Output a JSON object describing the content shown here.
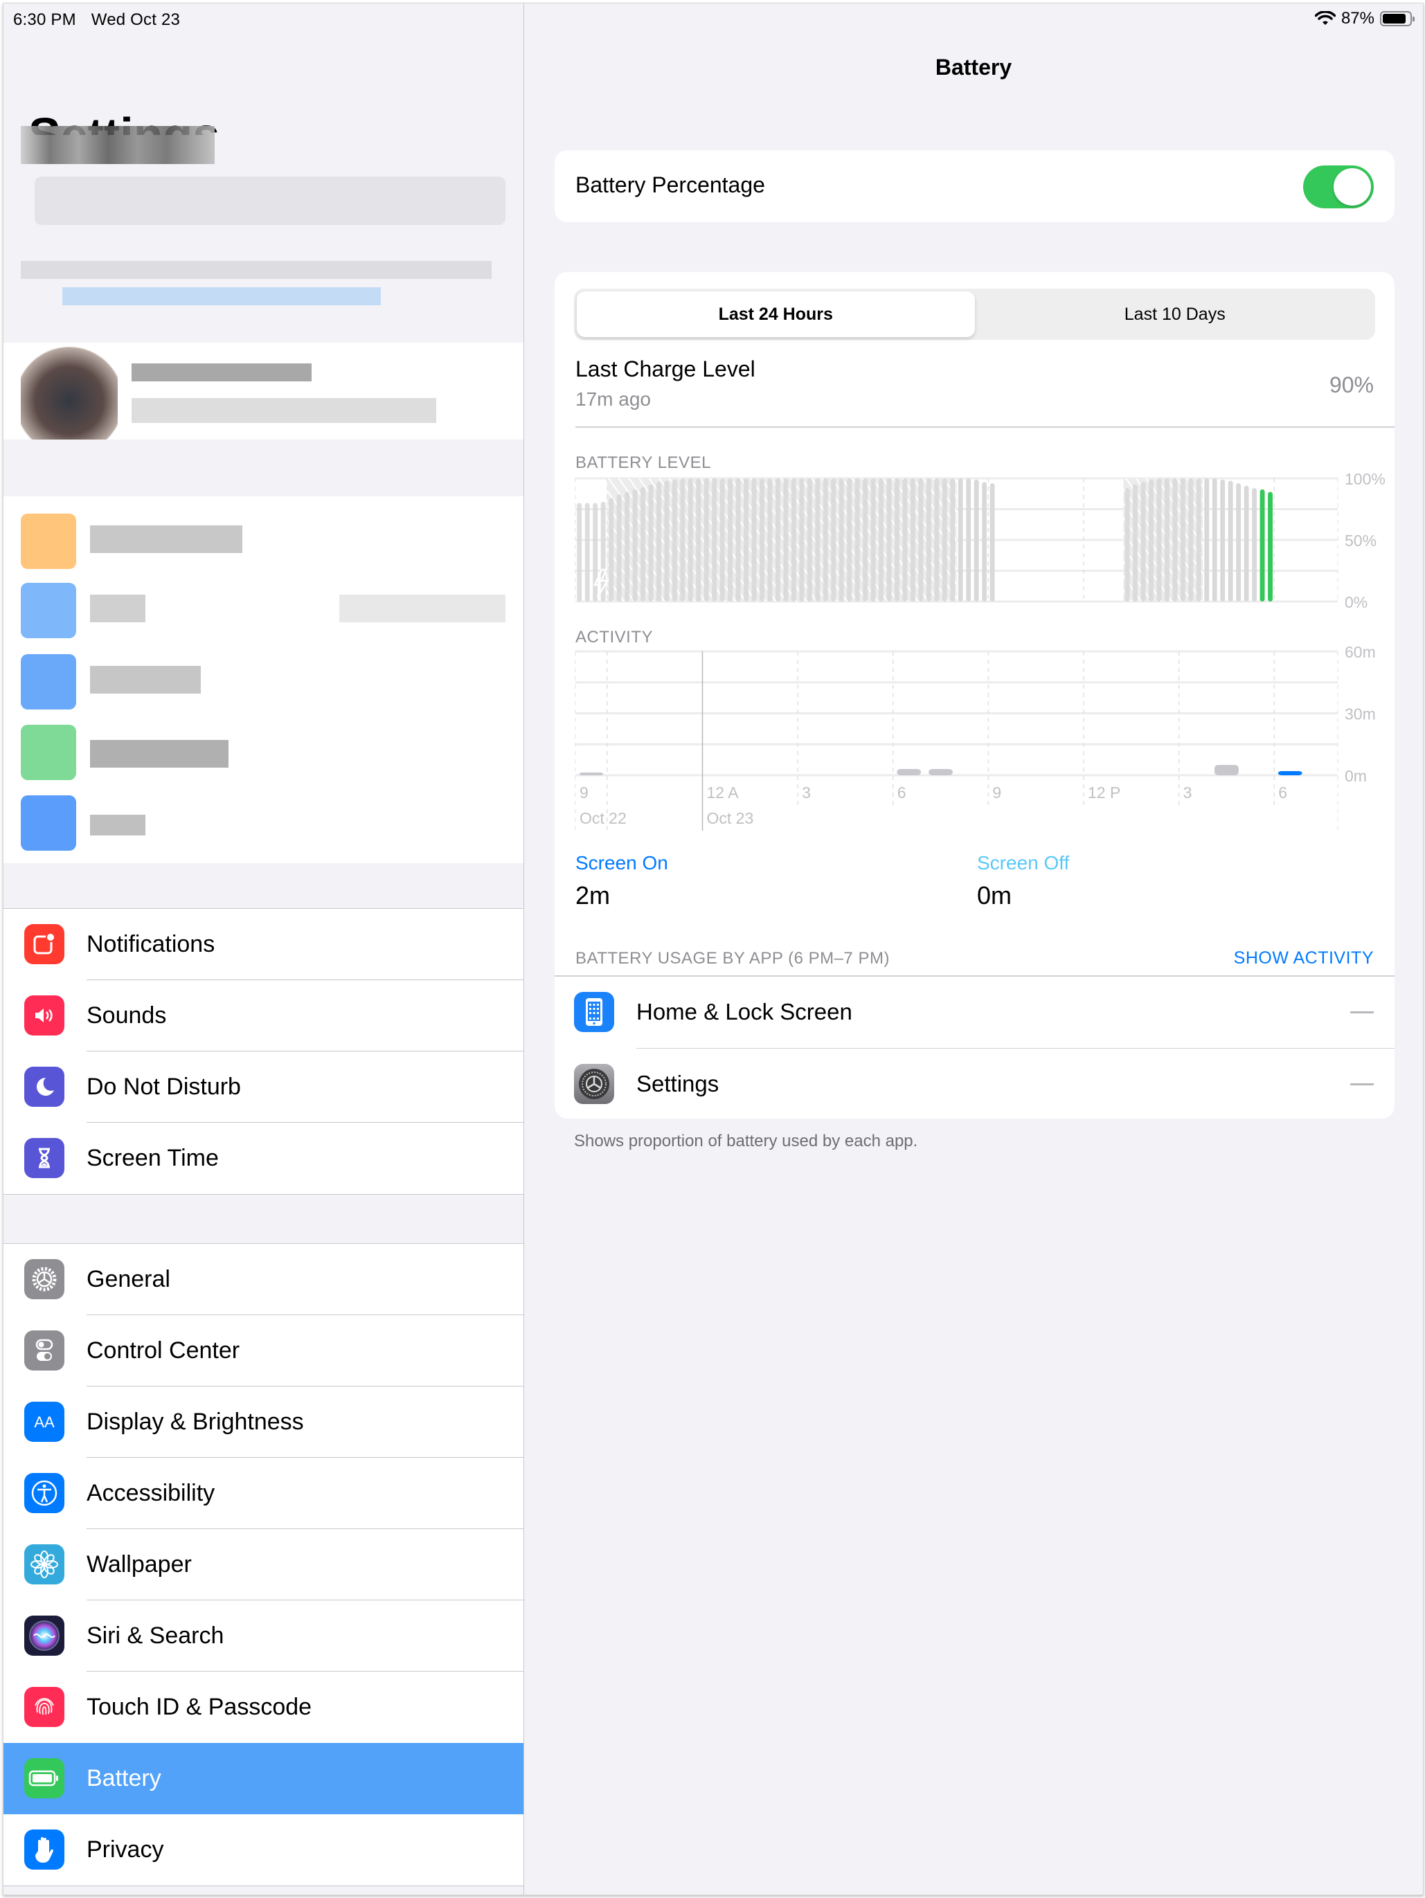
{
  "status_bar": {
    "time": "6:30 PM",
    "date": "Wed Oct 23",
    "battery_percent": "87%",
    "battery_fill": 0.87,
    "wifi_icon": "wifi-icon",
    "battery_icon": "battery-icon"
  },
  "sidebar": {
    "title": "Settings",
    "groups": [
      [
        {
          "label": "Notifications",
          "icon": "notifications-icon",
          "color": "#ff3b30"
        },
        {
          "label": "Sounds",
          "icon": "speaker-icon",
          "color": "#ff2d55"
        },
        {
          "label": "Do Not Disturb",
          "icon": "moon-icon",
          "color": "#5856d6"
        },
        {
          "label": "Screen Time",
          "icon": "hourglass-icon",
          "color": "#5856d6"
        }
      ],
      [
        {
          "label": "General",
          "icon": "gear-icon",
          "color": "#8e8e93"
        },
        {
          "label": "Control Center",
          "icon": "toggles-icon",
          "color": "#8e8e93"
        },
        {
          "label": "Display & Brightness",
          "icon": "text-size-icon",
          "color": "#007aff"
        },
        {
          "label": "Accessibility",
          "icon": "accessibility-icon",
          "color": "#007aff"
        },
        {
          "label": "Wallpaper",
          "icon": "flower-icon",
          "color": "#34aadc"
        },
        {
          "label": "Siri & Search",
          "icon": "siri-icon",
          "color": "#1c1c3a"
        },
        {
          "label": "Touch ID & Passcode",
          "icon": "fingerprint-icon",
          "color": "#ff2d55"
        },
        {
          "label": "Battery",
          "icon": "battery-icon",
          "color": "#34c759",
          "selected": true
        },
        {
          "label": "Privacy",
          "icon": "hand-icon",
          "color": "#007aff"
        }
      ]
    ],
    "selection_color": "#52a2fa"
  },
  "detail": {
    "title": "Battery",
    "battery_percentage": {
      "label": "Battery Percentage",
      "enabled": true
    },
    "tabs": [
      {
        "label": "Last 24 Hours",
        "active": true
      },
      {
        "label": "Last 10 Days",
        "active": false
      }
    ],
    "last_charge": {
      "label": "Last Charge Level",
      "sub": "17m ago",
      "value": "90%"
    },
    "battery_level_label": "BATTERY LEVEL",
    "activity_label": "ACTIVITY",
    "screen_on": {
      "label": "Screen On",
      "value": "2m"
    },
    "screen_off": {
      "label": "Screen Off",
      "value": "0m"
    },
    "usage_header": "BATTERY USAGE BY APP (6 PM–7 PM)",
    "show_activity": "SHOW ACTIVITY",
    "apps": [
      {
        "name": "Home & Lock Screen",
        "icon": "home-screen-icon",
        "usage": "—"
      },
      {
        "name": "Settings",
        "icon": "settings-app-icon",
        "usage": "—"
      }
    ],
    "footnote": "Shows proportion of battery used by each app."
  },
  "chart_data": [
    {
      "type": "bar",
      "title": "BATTERY LEVEL",
      "ylim": [
        0,
        100
      ],
      "yticks": [
        "100%",
        "50%",
        "0%"
      ],
      "x_range_hours": [
        20,
        44
      ],
      "bar_interval_min": 15,
      "charging_icon": "lightning-icon",
      "segments": [
        {
          "start_hour": 20.0,
          "values": [
            80,
            80,
            80,
            81,
            84,
            87,
            89,
            91,
            93,
            95,
            97,
            98,
            99,
            100,
            100,
            100,
            100,
            100,
            100,
            100,
            100,
            100,
            100,
            100,
            100,
            100,
            100,
            100,
            100,
            100,
            100,
            100,
            100,
            100,
            100,
            100,
            100,
            100,
            100,
            100,
            100,
            100,
            100,
            100,
            100,
            100,
            100,
            100,
            100,
            100,
            99,
            97,
            96
          ],
          "charging_until_index": 48
        },
        {
          "start_hour": 37.25,
          "values": [
            92,
            95,
            97,
            99,
            100,
            100,
            100,
            100,
            100,
            100,
            100,
            100,
            99,
            98,
            96,
            94,
            92,
            91,
            89
          ],
          "charging_until_index": 10,
          "highlight_last": 2,
          "highlight_color": "#34c759"
        }
      ],
      "bar_color": "#d9d9d9"
    },
    {
      "type": "bar",
      "title": "ACTIVITY",
      "ylim": [
        0,
        60
      ],
      "yticks": [
        "60m",
        "30m",
        "0m"
      ],
      "x_range_hours": [
        20,
        44
      ],
      "xticks": [
        {
          "hour": 21,
          "label": "9",
          "date": "Oct 22"
        },
        {
          "hour": 24,
          "label": "12 A",
          "date": "Oct 23"
        },
        {
          "hour": 27,
          "label": "3"
        },
        {
          "hour": 30,
          "label": "6"
        },
        {
          "hour": 33,
          "label": "9"
        },
        {
          "hour": 36,
          "label": "12 P"
        },
        {
          "hour": 39,
          "label": "3"
        },
        {
          "hour": 42,
          "label": "6"
        }
      ],
      "bars": [
        {
          "hour": 20.5,
          "minutes": 1,
          "color": "#c7c7cc"
        },
        {
          "hour": 30.5,
          "minutes": 3,
          "color": "#c7c7cc"
        },
        {
          "hour": 31.5,
          "minutes": 3,
          "color": "#c7c7cc"
        },
        {
          "hour": 40.5,
          "minutes": 5,
          "color": "#c7c7cc"
        },
        {
          "hour": 42.5,
          "minutes": 2,
          "color": "#007aff"
        }
      ]
    }
  ]
}
